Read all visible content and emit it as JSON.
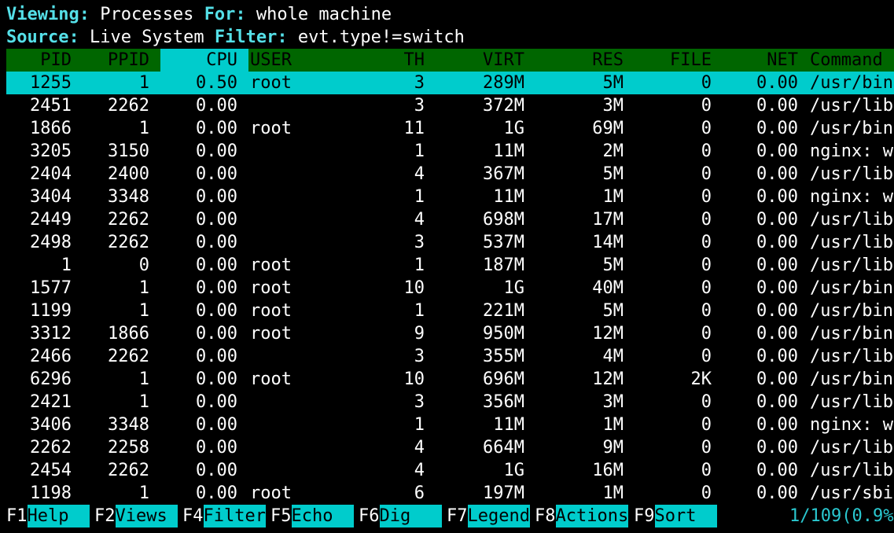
{
  "top": {
    "viewing_label": "Viewing:",
    "viewing_value": "Processes",
    "for_label": "For:",
    "for_value": "whole machine",
    "source_label": "Source:",
    "source_value": "Live System",
    "filter_label": "Filter:",
    "filter_value": "evt.type!=switch"
  },
  "columns": [
    "PID",
    "PPID",
    "CPU",
    "USER",
    "TH",
    "VIRT",
    "RES",
    "FILE",
    "NET",
    "Command"
  ],
  "rows": [
    {
      "pid": "1255",
      "ppid": "1",
      "cpu": "0.50",
      "user": "root",
      "th": "3",
      "virt": "289M",
      "res": "5M",
      "file": "0",
      "net": "0.00",
      "cmd": "/usr/bin"
    },
    {
      "pid": "2451",
      "ppid": "2262",
      "cpu": "0.00",
      "user": "",
      "th": "3",
      "virt": "372M",
      "res": "3M",
      "file": "0",
      "net": "0.00",
      "cmd": "/usr/lib"
    },
    {
      "pid": "1866",
      "ppid": "1",
      "cpu": "0.00",
      "user": "root",
      "th": "11",
      "virt": "1G",
      "res": "69M",
      "file": "0",
      "net": "0.00",
      "cmd": "/usr/bin"
    },
    {
      "pid": "3205",
      "ppid": "3150",
      "cpu": "0.00",
      "user": "",
      "th": "1",
      "virt": "11M",
      "res": "2M",
      "file": "0",
      "net": "0.00",
      "cmd": "nginx: w"
    },
    {
      "pid": "2404",
      "ppid": "2400",
      "cpu": "0.00",
      "user": "",
      "th": "4",
      "virt": "367M",
      "res": "5M",
      "file": "0",
      "net": "0.00",
      "cmd": "/usr/lib"
    },
    {
      "pid": "3404",
      "ppid": "3348",
      "cpu": "0.00",
      "user": "",
      "th": "1",
      "virt": "11M",
      "res": "1M",
      "file": "0",
      "net": "0.00",
      "cmd": "nginx: w"
    },
    {
      "pid": "2449",
      "ppid": "2262",
      "cpu": "0.00",
      "user": "",
      "th": "4",
      "virt": "698M",
      "res": "17M",
      "file": "0",
      "net": "0.00",
      "cmd": "/usr/lib"
    },
    {
      "pid": "2498",
      "ppid": "2262",
      "cpu": "0.00",
      "user": "",
      "th": "3",
      "virt": "537M",
      "res": "14M",
      "file": "0",
      "net": "0.00",
      "cmd": "/usr/lib"
    },
    {
      "pid": "1",
      "ppid": "0",
      "cpu": "0.00",
      "user": "root",
      "th": "1",
      "virt": "187M",
      "res": "5M",
      "file": "0",
      "net": "0.00",
      "cmd": "/usr/lib"
    },
    {
      "pid": "1577",
      "ppid": "1",
      "cpu": "0.00",
      "user": "root",
      "th": "10",
      "virt": "1G",
      "res": "40M",
      "file": "0",
      "net": "0.00",
      "cmd": "/usr/bin"
    },
    {
      "pid": "1199",
      "ppid": "1",
      "cpu": "0.00",
      "user": "root",
      "th": "1",
      "virt": "221M",
      "res": "5M",
      "file": "0",
      "net": "0.00",
      "cmd": "/usr/bin"
    },
    {
      "pid": "3312",
      "ppid": "1866",
      "cpu": "0.00",
      "user": "root",
      "th": "9",
      "virt": "950M",
      "res": "12M",
      "file": "0",
      "net": "0.00",
      "cmd": "/usr/bin"
    },
    {
      "pid": "2466",
      "ppid": "2262",
      "cpu": "0.00",
      "user": "",
      "th": "3",
      "virt": "355M",
      "res": "4M",
      "file": "0",
      "net": "0.00",
      "cmd": "/usr/lib"
    },
    {
      "pid": "6296",
      "ppid": "1",
      "cpu": "0.00",
      "user": "root",
      "th": "10",
      "virt": "696M",
      "res": "12M",
      "file": "2K",
      "net": "0.00",
      "cmd": "/usr/bin"
    },
    {
      "pid": "2421",
      "ppid": "1",
      "cpu": "0.00",
      "user": "",
      "th": "3",
      "virt": "356M",
      "res": "3M",
      "file": "0",
      "net": "0.00",
      "cmd": "/usr/lib"
    },
    {
      "pid": "3406",
      "ppid": "3348",
      "cpu": "0.00",
      "user": "",
      "th": "1",
      "virt": "11M",
      "res": "1M",
      "file": "0",
      "net": "0.00",
      "cmd": "nginx: w"
    },
    {
      "pid": "2262",
      "ppid": "2258",
      "cpu": "0.00",
      "user": "",
      "th": "4",
      "virt": "664M",
      "res": "9M",
      "file": "0",
      "net": "0.00",
      "cmd": "/usr/lib"
    },
    {
      "pid": "2454",
      "ppid": "2262",
      "cpu": "0.00",
      "user": "",
      "th": "4",
      "virt": "1G",
      "res": "16M",
      "file": "0",
      "net": "0.00",
      "cmd": "/usr/lib"
    },
    {
      "pid": "1198",
      "ppid": "1",
      "cpu": "0.00",
      "user": "root",
      "th": "6",
      "virt": "197M",
      "res": "1M",
      "file": "0",
      "net": "0.00",
      "cmd": "/usr/sbi"
    }
  ],
  "footer": {
    "keys": [
      {
        "key": "F1",
        "label": "Help  "
      },
      {
        "key": "F2",
        "label": "Views "
      },
      {
        "key": "F4",
        "label": "Filter"
      },
      {
        "key": "F5",
        "label": "Echo  "
      },
      {
        "key": "F6",
        "label": "Dig   "
      },
      {
        "key": "F7",
        "label": "Legend"
      },
      {
        "key": "F8",
        "label": "Actions"
      },
      {
        "key": "F9",
        "label": "Sort  "
      }
    ],
    "status": "1/109(0.9%"
  },
  "colors": {
    "label_cyan": "#55e0e8",
    "header_green": "#006600",
    "highlight_cyan": "#00cccc",
    "status_cyan": "#2ac8d0"
  }
}
